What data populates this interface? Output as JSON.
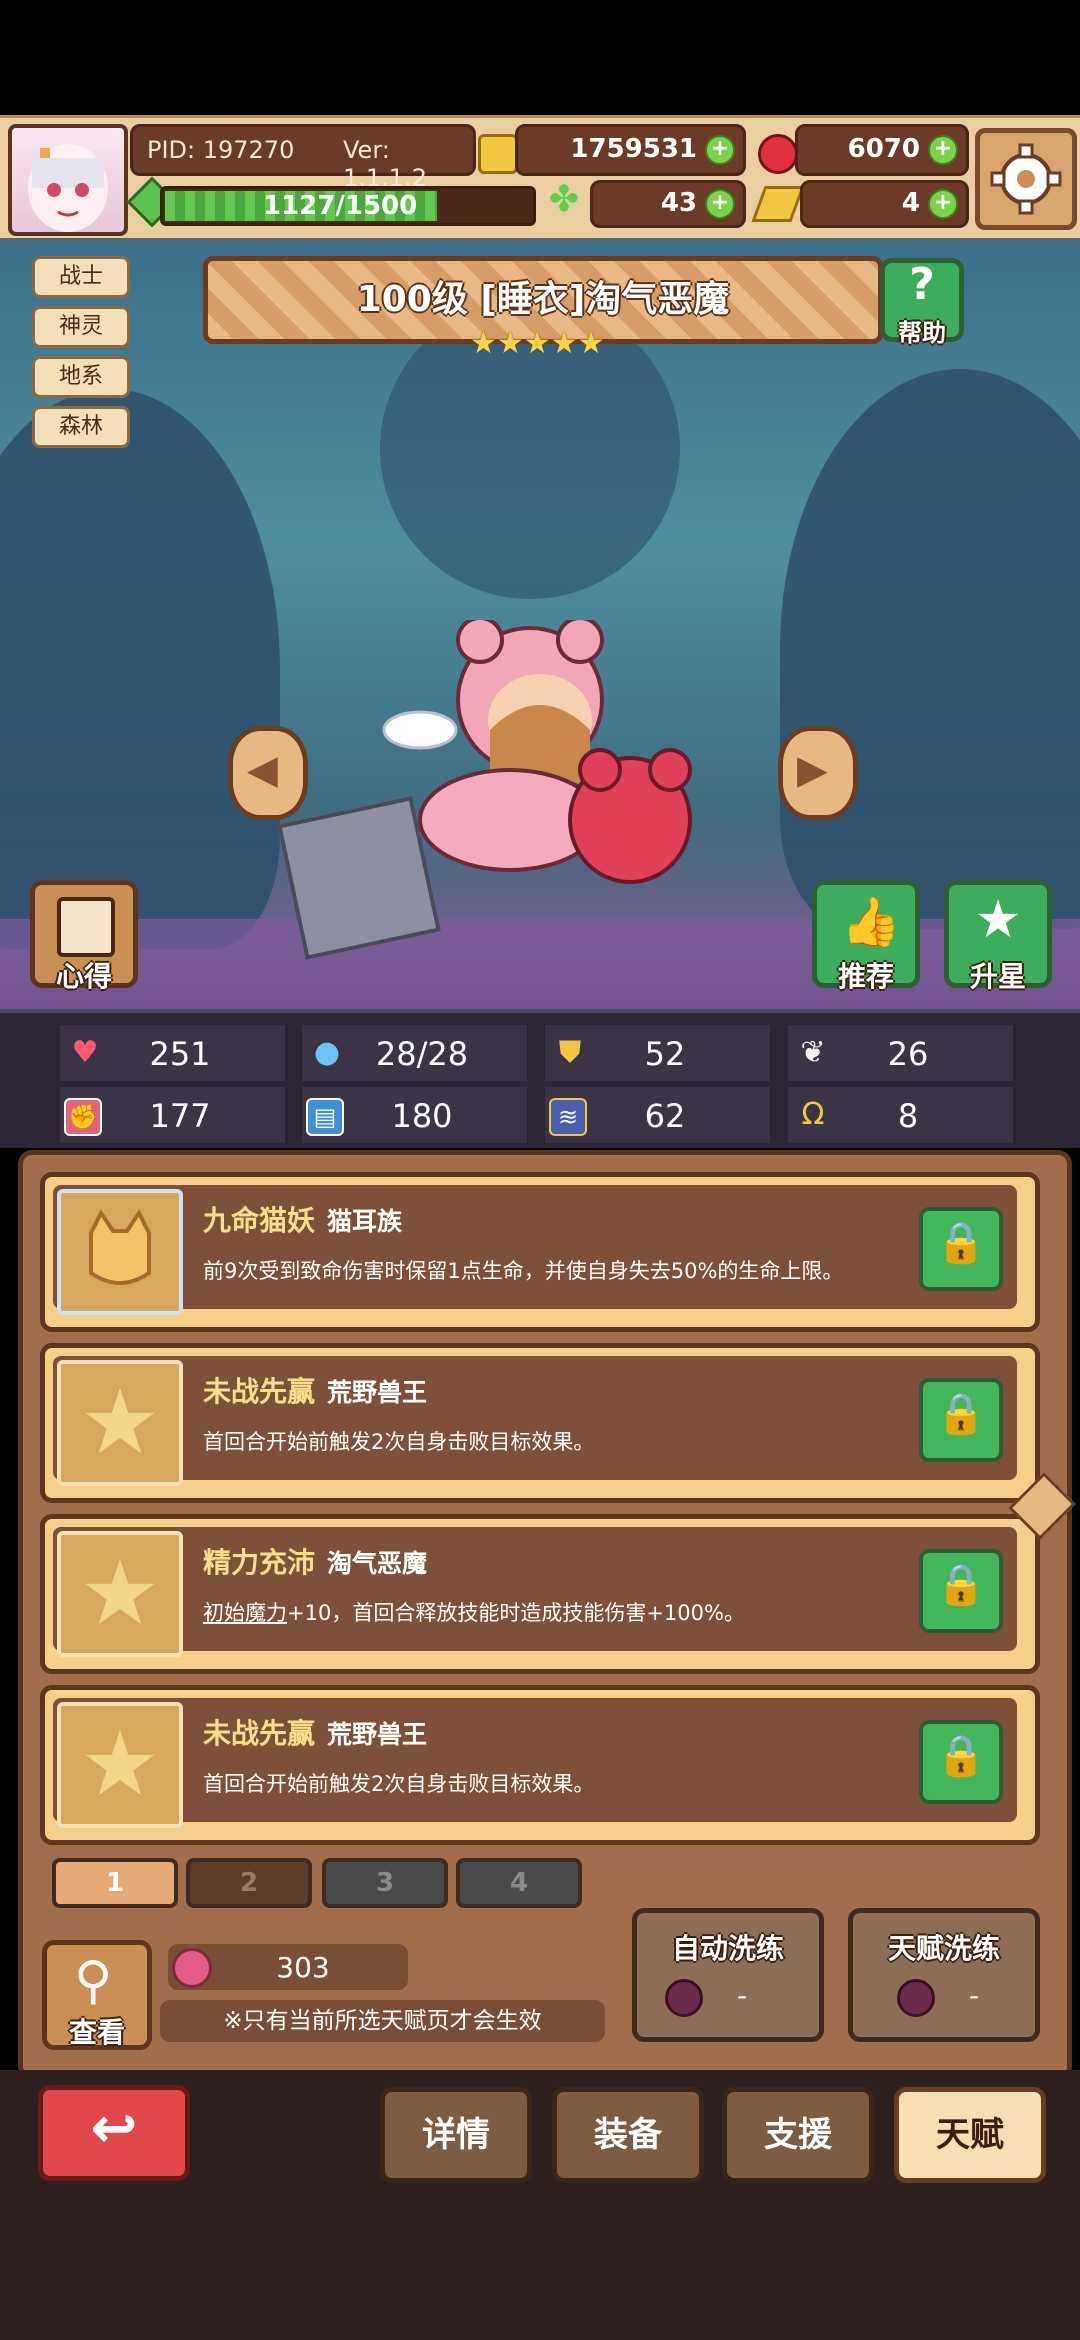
{
  "header": {
    "pid": "PID: 197270",
    "version": "Ver: 1.1.1.2",
    "gold": "1759531",
    "gems": "6070",
    "energy": "1127/1500",
    "clover": "43",
    "key": "4"
  },
  "tags": [
    "战士",
    "神灵",
    "地系",
    "森林"
  ],
  "hero": {
    "title": "100级 [睡衣]淘气恶魔",
    "stars": "★★★★★",
    "help_label": "帮助",
    "insight_label": "心得",
    "recommend_label": "推荐",
    "star_up_label": "升星"
  },
  "stats": [
    "251",
    "28/28",
    "52",
    "26",
    "177",
    "180",
    "62",
    "8"
  ],
  "talents": [
    {
      "name": "九命猫妖",
      "source": "猫耳族",
      "desc": "前9次受到致命伤害时保留1点生命，并使自身失去50%的生命上限。"
    },
    {
      "name": "未战先赢",
      "source": "荒野兽王",
      "desc": "首回合开始前触发2次自身击败目标效果。"
    },
    {
      "name": "精力充沛",
      "source": "淘气恶魔",
      "desc_link": "初始魔力",
      "desc": "+10，首回合释放技能时造成技能伤害+100%。"
    },
    {
      "name": "未战先赢",
      "source": "荒野兽王",
      "desc": "首回合开始前触发2次自身击败目标效果。"
    }
  ],
  "pages": [
    "1",
    "2",
    "3",
    "4"
  ],
  "resource_count": "303",
  "view_label": "查看",
  "note": "※只有当前所选天赋页才会生效",
  "auto_reroll_label": "自动洗练",
  "talent_reroll_label": "天赋洗练",
  "reroll_cost": "-",
  "tabs": [
    "详情",
    "装备",
    "支援",
    "天赋"
  ],
  "colors": {
    "accent": "#3cad5a",
    "brown": "#6b3b28",
    "gold": "#ffe08a",
    "back": "#e0484a"
  }
}
